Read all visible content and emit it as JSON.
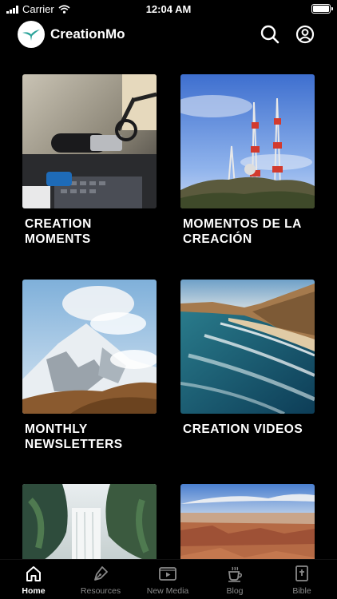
{
  "status_bar": {
    "carrier": "Carrier",
    "time": "12:04 AM"
  },
  "header": {
    "title": "CreationMo"
  },
  "cards": [
    {
      "title": "CREATION MOMENTS"
    },
    {
      "title": "MOMENTOS DE LA CREACIÓN"
    },
    {
      "title": "MONTHLY NEWSLETTERS"
    },
    {
      "title": "CREATION VIDEOS"
    },
    {
      "title": ""
    },
    {
      "title": ""
    }
  ],
  "tabs": [
    {
      "label": "Home",
      "icon": "home-icon",
      "active": true
    },
    {
      "label": "Resources",
      "icon": "pen-nib-icon",
      "active": false
    },
    {
      "label": "New Media",
      "icon": "play-icon",
      "active": false
    },
    {
      "label": "Blog",
      "icon": "coffee-cup-icon",
      "active": false
    },
    {
      "label": "Bible",
      "icon": "bible-icon",
      "active": false
    }
  ],
  "colors": {
    "background": "#000000",
    "text": "#ffffff",
    "inactive_tab": "#8a8a8a"
  }
}
